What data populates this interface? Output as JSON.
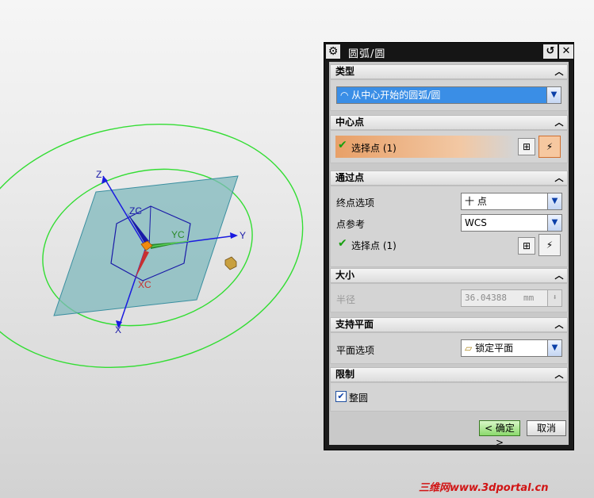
{
  "viewport": {
    "axes": {
      "z": "Z",
      "zc": "ZC",
      "yc": "YC",
      "y": "Y",
      "xc": "XC",
      "x": "X"
    }
  },
  "dialog": {
    "title": "圆弧/圆",
    "sections": {
      "type": {
        "title": "类型",
        "combo_value": "从中心开始的圆弧/圆"
      },
      "center": {
        "title": "中心点",
        "select_label": "选择点 (1)"
      },
      "through": {
        "title": "通过点",
        "endpoint_label": "终点选项",
        "endpoint_value": "十 点",
        "reference_label": "点参考",
        "reference_value": "WCS",
        "select_label": "选择点 (1)"
      },
      "size": {
        "title": "大小",
        "radius_label": "半径",
        "radius_value": "36.04388",
        "radius_unit": "mm"
      },
      "support": {
        "title": "支持平面",
        "plane_label": "平面选项",
        "plane_value": "锁定平面"
      },
      "limits": {
        "title": "限制",
        "full_circle_label": "整圆",
        "full_circle_checked": true
      }
    },
    "buttons": {
      "ok": "< 确定 >",
      "cancel": "取消"
    }
  },
  "watermark": "三维网www.3dportal.cn"
}
